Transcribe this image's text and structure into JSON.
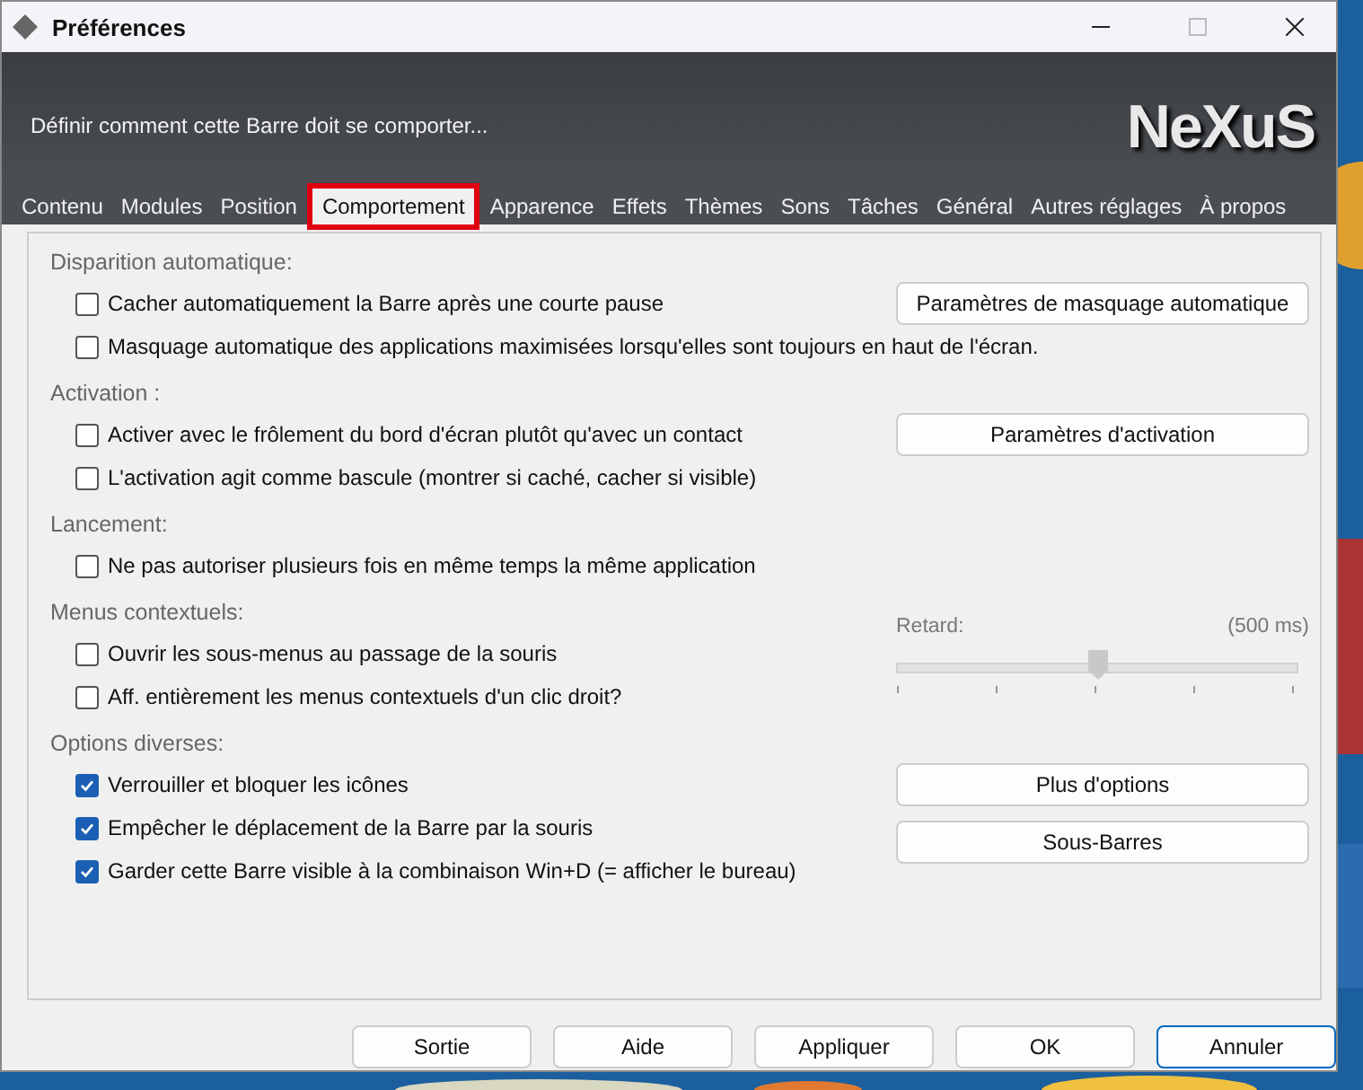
{
  "window": {
    "title": "Préférences"
  },
  "header": {
    "description": "Définir comment cette Barre doit se comporter...",
    "logo": "NeXuS"
  },
  "tabs": [
    {
      "label": "Contenu",
      "selected": false
    },
    {
      "label": "Modules",
      "selected": false
    },
    {
      "label": "Position",
      "selected": false
    },
    {
      "label": "Comportement",
      "selected": true
    },
    {
      "label": "Apparence",
      "selected": false
    },
    {
      "label": "Effets",
      "selected": false
    },
    {
      "label": "Thèmes",
      "selected": false
    },
    {
      "label": "Sons",
      "selected": false
    },
    {
      "label": "Tâches",
      "selected": false
    },
    {
      "label": "Général",
      "selected": false
    },
    {
      "label": "Autres réglages",
      "selected": false
    },
    {
      "label": "À propos",
      "selected": false
    }
  ],
  "sections": [
    {
      "title": "Disparition automatique:",
      "items": [
        {
          "label": "Cacher automatiquement la Barre après une courte pause",
          "checked": false
        },
        {
          "label": "Masquage automatique des applications maximisées lorsqu'elles sont toujours en haut de l'écran.",
          "checked": false
        }
      ],
      "side": {
        "kind": "buttons",
        "buttons": [
          "Paramètres de masquage automatique"
        ]
      }
    },
    {
      "title": "Activation :",
      "items": [
        {
          "label": "Activer avec le frôlement du bord d'écran plutôt qu'avec un contact",
          "checked": false
        },
        {
          "label": "L'activation agit comme bascule (montrer si caché, cacher si visible)",
          "checked": false
        }
      ],
      "side": {
        "kind": "buttons",
        "buttons": [
          "Paramètres d'activation"
        ]
      }
    },
    {
      "title": "Lancement:",
      "items": [
        {
          "label": "Ne pas autoriser plusieurs fois en même temps la même application",
          "checked": false
        }
      ]
    },
    {
      "title": "Menus contextuels:",
      "items": [
        {
          "label": "Ouvrir les sous-menus au passage de la souris",
          "checked": false
        },
        {
          "label": "Aff. entièrement les menus contextuels d'un clic droit?",
          "checked": false
        }
      ],
      "side": {
        "kind": "slider",
        "label": "Retard:",
        "reading": "(500 ms)",
        "level": 0.5
      }
    },
    {
      "title": "Options diverses:",
      "items": [
        {
          "label": "Verrouiller et bloquer les icônes",
          "checked": true
        },
        {
          "label": "Empêcher le déplacement de la Barre par la souris",
          "checked": true
        },
        {
          "label": "Garder cette Barre visible à la combinaison Win+D (= afficher le bureau)",
          "checked": true
        }
      ],
      "side": {
        "kind": "buttons",
        "buttons": [
          "Plus d'options",
          "Sous-Barres"
        ]
      }
    }
  ],
  "footer_buttons": [
    {
      "label": "Sortie",
      "primary": false
    },
    {
      "label": "Aide",
      "primary": false
    },
    {
      "label": "Appliquer",
      "primary": false
    },
    {
      "label": "OK",
      "primary": false
    },
    {
      "label": "Annuler",
      "primary": true
    }
  ]
}
